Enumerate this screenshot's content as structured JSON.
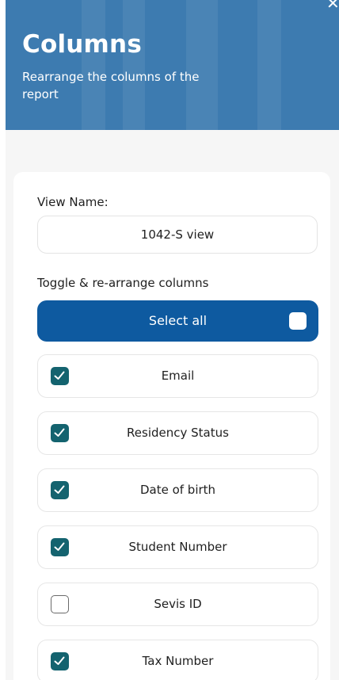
{
  "header": {
    "title": "Columns",
    "subtitle": "Rearrange the columns of the report",
    "background_color": "#3d7bb0",
    "close_icon": "close-icon"
  },
  "form": {
    "view_name_label": "View Name:",
    "view_name_value": "1042-S view",
    "toggle_label": "Toggle & re-arrange columns"
  },
  "select_all": {
    "label": "Select all",
    "checked": false,
    "color": "#0e5aa0"
  },
  "columns": [
    {
      "label": "Email",
      "checked": true
    },
    {
      "label": "Residency Status",
      "checked": true
    },
    {
      "label": "Date of birth",
      "checked": true
    },
    {
      "label": "Student Number",
      "checked": true
    },
    {
      "label": "Sevis ID",
      "checked": false
    },
    {
      "label": "Tax Number",
      "checked": true
    }
  ],
  "colors": {
    "checkbox_checked": "#14636f"
  }
}
